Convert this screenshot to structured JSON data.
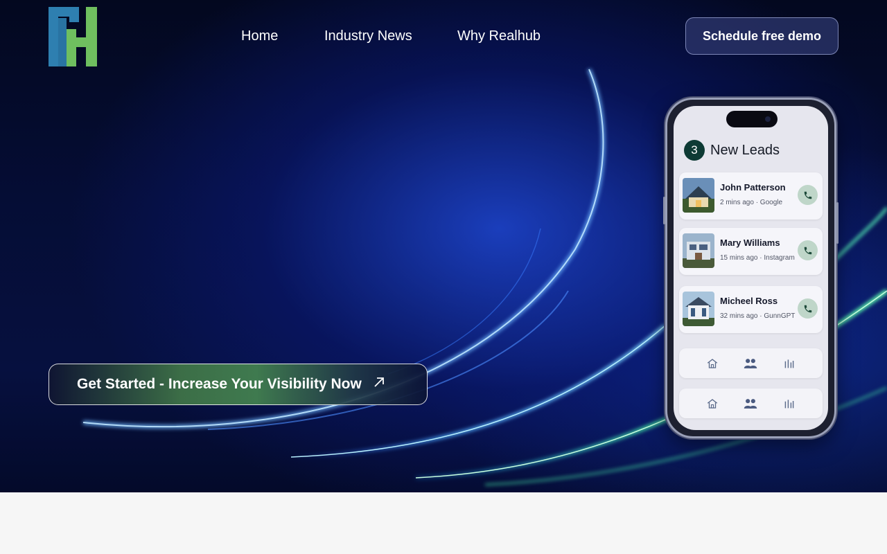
{
  "brand": {
    "logo_icon": "realhub-logo-icon",
    "colors": {
      "logo_blue": "#2e7fb0",
      "logo_green": "#6fbf5f"
    }
  },
  "nav": {
    "items": [
      {
        "label": "Home"
      },
      {
        "label": "Industry News"
      },
      {
        "label": "Why Realhub"
      }
    ],
    "demo_button": "Schedule free demo"
  },
  "hero": {
    "cta_label": "Get Started - Increase Your Visibility Now",
    "cta_icon": "arrow-up-right-icon"
  },
  "phone": {
    "leads_count": "3",
    "leads_title": "New Leads",
    "leads": [
      {
        "name": "John Patterson",
        "meta": "2 mins ago · Google"
      },
      {
        "name": "Mary Williams",
        "meta": "15 mins ago · Instagram"
      },
      {
        "name": "Micheel Ross",
        "meta": "32 mins ago · GunnGPT"
      }
    ],
    "tab_icons": [
      "home-icon",
      "users-icon",
      "bar-chart-icon"
    ]
  }
}
